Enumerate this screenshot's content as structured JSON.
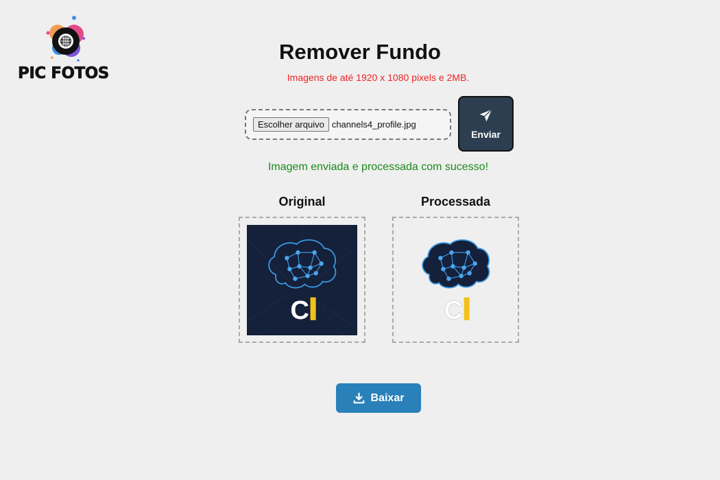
{
  "brand": {
    "name": "PIC FOTOS"
  },
  "header": {
    "title": "Remover Fundo",
    "subtitle": "Imagens de até 1920 x 1080 pixels e 2MB."
  },
  "upload": {
    "choose_label": "Escolher arquivo",
    "file_name": "channels4_profile.jpg",
    "send_label": "Enviar",
    "send_icon": "paper-plane-icon"
  },
  "status": {
    "message": "Imagem enviada e processada com sucesso!"
  },
  "images": {
    "original_label": "Original",
    "processed_label": "Processada",
    "logo_text": "CI"
  },
  "download": {
    "label": "Baixar",
    "icon": "download-icon"
  },
  "colors": {
    "title": "#111111",
    "subtitle": "#ee2222",
    "status": "#1a8a1a",
    "send_button": "#2d3e50",
    "download_button": "#2a80b9",
    "image_bg": "#15203a",
    "brain_accent": "#3a97e0",
    "logo_yellow": "#f3c11b"
  }
}
